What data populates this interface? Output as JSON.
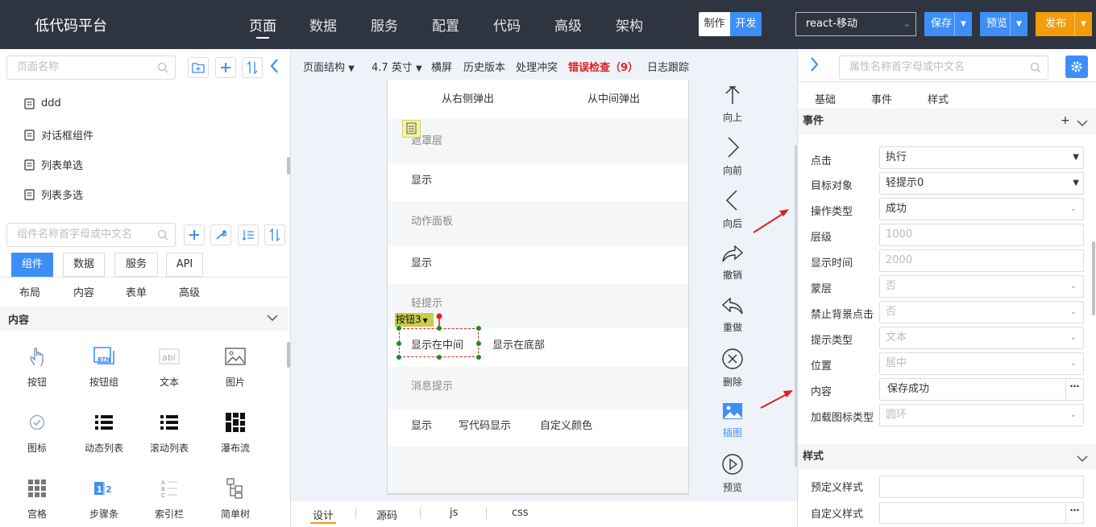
{
  "app": {
    "title": "低代码平台"
  },
  "nav": [
    "页面",
    "数据",
    "服务",
    "配置",
    "代码",
    "高级",
    "架构"
  ],
  "mode": {
    "make": "制作",
    "dev": "开发"
  },
  "device": {
    "selected": "react-移动"
  },
  "actions": {
    "save": "保存",
    "preview": "预览",
    "publish": "发布"
  },
  "colors": {
    "topbar": "#2e3440",
    "accent": "#3e8ef7",
    "save": "#3e8ef7",
    "preview": "#3e8ef7",
    "publish": "#f49c0c",
    "error": "#e02020"
  },
  "pages": {
    "search_placeholder": "页面名称",
    "items": [
      "ddd",
      "对话框组件",
      "列表单选",
      "列表多选"
    ]
  },
  "components": {
    "search_placeholder": "组件名称首字母或中文名",
    "tabs": [
      "组件",
      "数据",
      "服务",
      "API"
    ],
    "subcats": [
      "布局",
      "内容",
      "表单",
      "高级"
    ],
    "section": "内容",
    "items": [
      {
        "label": "按钮",
        "icon": "hand-pointer-icon"
      },
      {
        "label": "按钮组",
        "icon": "button-group-icon"
      },
      {
        "label": "文本",
        "icon": "text-icon"
      },
      {
        "label": "图片",
        "icon": "image-icon"
      },
      {
        "label": "图标",
        "icon": "check-circle-icon"
      },
      {
        "label": "动态列表",
        "icon": "list-icon"
      },
      {
        "label": "滚动列表",
        "icon": "list-icon"
      },
      {
        "label": "瀑布流",
        "icon": "waterfall-icon"
      },
      {
        "label": "宫格",
        "icon": "grid-icon"
      },
      {
        "label": "步骤条",
        "icon": "steps-icon"
      },
      {
        "label": "索引栏",
        "icon": "index-bar-icon"
      },
      {
        "label": "简单树",
        "icon": "tree-icon"
      }
    ]
  },
  "toolbar": {
    "structure": "页面结构",
    "size": "4.7 英寸",
    "landscape": "横屏",
    "history": "历史版本",
    "conflict": "处理冲突",
    "errors": "错误检查（9）",
    "log": "日志跟踪"
  },
  "canvas": {
    "row1": {
      "a": "从右侧弹出",
      "b": "从中间弹出"
    },
    "sec_mask": "遮罩层",
    "row_mask": "显示",
    "sec_action": "动作面板",
    "row_action": "显示",
    "sec_toast": "轻提示",
    "row_toast": {
      "a": "显示在中间",
      "b": "显示在底部"
    },
    "sec_msg": "消息提示",
    "row_msg": {
      "a": "显示",
      "b": "写代码显示",
      "c": "自定义颜色"
    },
    "selected_tag": "按钮3"
  },
  "side_tools": [
    "向上",
    "向前",
    "向后",
    "撤销",
    "重做",
    "删除",
    "插图",
    "预览"
  ],
  "bottom_tabs": [
    "设计",
    "源码",
    "js",
    "css"
  ],
  "props": {
    "search_placeholder": "属性名称首字母或中文名",
    "tabs": [
      "基础",
      "事件",
      "样式"
    ],
    "event_section": "事件",
    "fields": [
      {
        "label": "点击",
        "value": "执行"
      },
      {
        "label": "目标对象",
        "value": "轻提示0"
      },
      {
        "label": "操作类型",
        "value": "成功"
      },
      {
        "label": "层级",
        "value": "1000"
      },
      {
        "label": "显示时间",
        "value": "2000"
      },
      {
        "label": "蒙层",
        "value": "否"
      },
      {
        "label": "禁止背景点击",
        "value": "否"
      },
      {
        "label": "提示类型",
        "value": "文本"
      },
      {
        "label": "位置",
        "value": "居中"
      },
      {
        "label": "内容",
        "value": "保存成功"
      },
      {
        "label": "加载图标类型",
        "value": "圆环"
      }
    ],
    "style_section": "样式",
    "style_fields": [
      {
        "label": "预定义样式",
        "value": ""
      },
      {
        "label": "自定义样式",
        "value": ""
      }
    ]
  }
}
